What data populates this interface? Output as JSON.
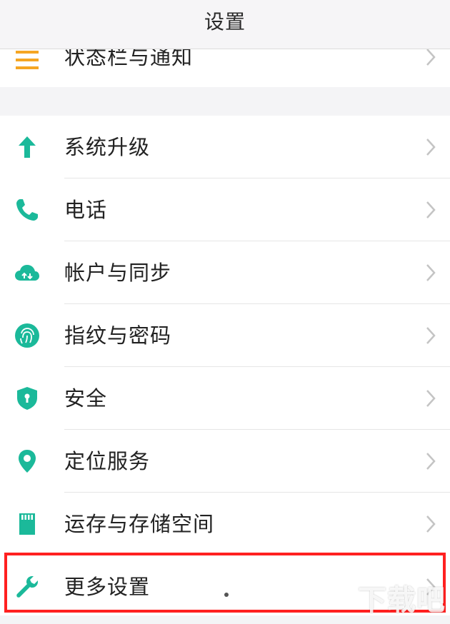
{
  "header": {
    "title": "设置"
  },
  "colors": {
    "accent": "#1bb99a",
    "orange": "#f5a623",
    "highlight": "#ff2020",
    "chevron": "#c4c4c4"
  },
  "items": [
    {
      "label": "状态栏与通知",
      "icon": "menu-lines-icon"
    },
    {
      "label": "系统升级",
      "icon": "arrow-up-icon"
    },
    {
      "label": "电话",
      "icon": "phone-icon"
    },
    {
      "label": "帐户与同步",
      "icon": "cloud-sync-icon"
    },
    {
      "label": "指纹与密码",
      "icon": "fingerprint-icon"
    },
    {
      "label": "安全",
      "icon": "shield-icon"
    },
    {
      "label": "定位服务",
      "icon": "location-pin-icon"
    },
    {
      "label": "运存与存储空间",
      "icon": "sd-card-icon"
    },
    {
      "label": "更多设置",
      "icon": "wrench-icon"
    }
  ],
  "watermark": "下载吧"
}
